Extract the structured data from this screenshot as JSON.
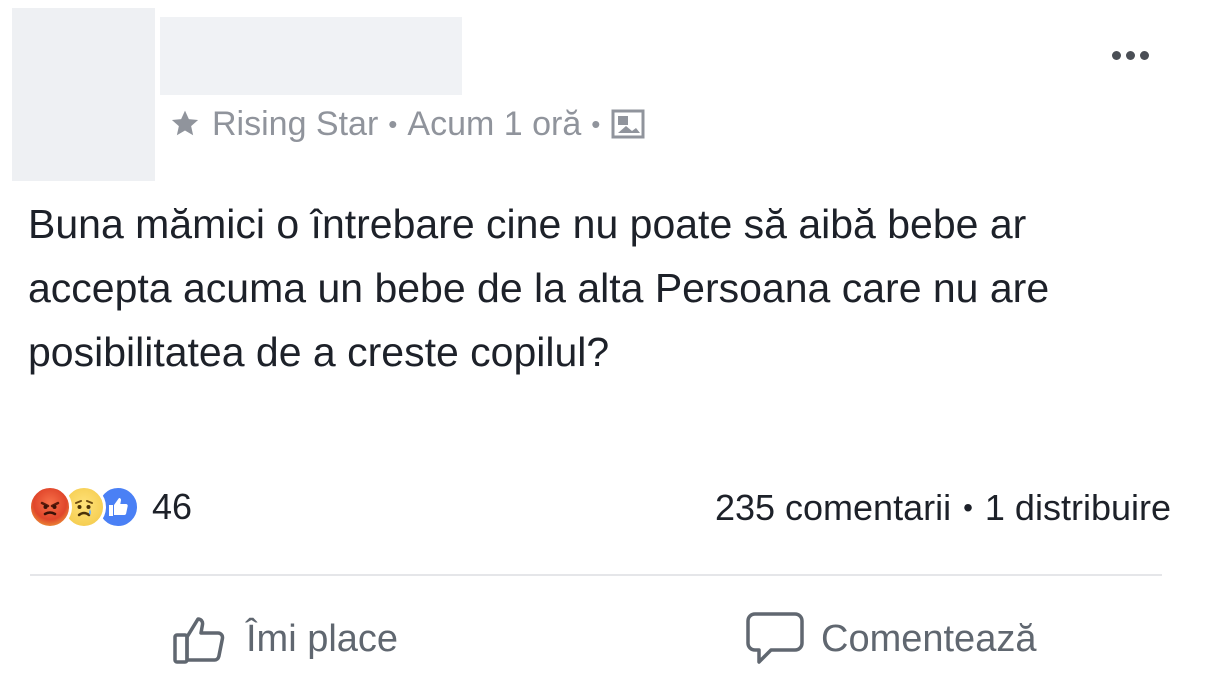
{
  "post": {
    "group_badge": "Rising Star",
    "separator": "•",
    "timestamp": "Acum 1 oră",
    "audience_icon": "photo-audience-icon",
    "text": "Buna mămici o întrebare cine nu poate să aibă bebe ar accepta acuma un bebe de la alta Persoana care nu are posibilitatea de a creste copilul?"
  },
  "reactions": {
    "icons": [
      "angry-icon",
      "sad-icon",
      "like-icon"
    ],
    "count": "46"
  },
  "stats": {
    "comments": "235 comentarii",
    "separator": "•",
    "shares": "1 distribuire"
  },
  "actions": {
    "like_label": "Îmi place",
    "comment_label": "Comentează"
  },
  "colors": {
    "meta_text": "#90949c",
    "action_text": "#606770",
    "like_blue": "#4a80f5",
    "angry_red": "#e0462b",
    "sad_yellow": "#f2c744"
  }
}
